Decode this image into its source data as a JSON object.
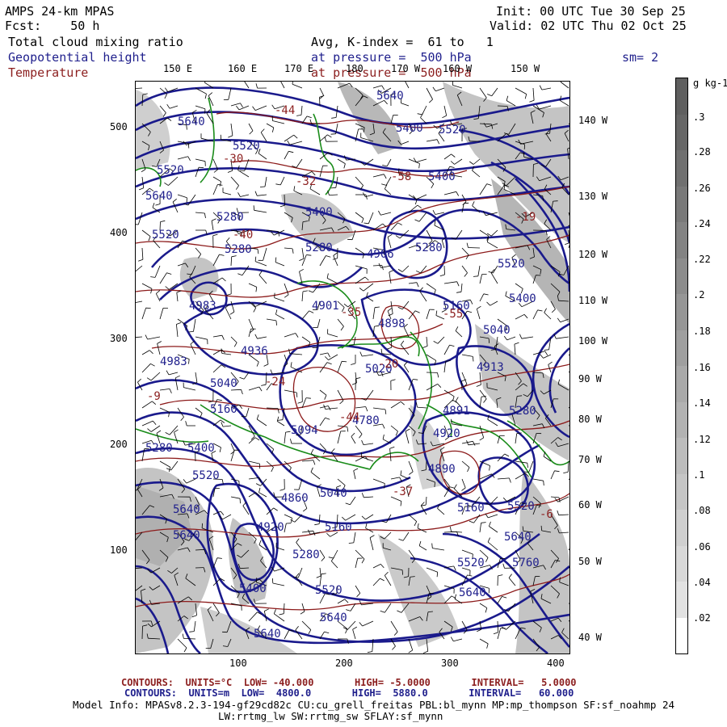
{
  "header": {
    "model": "AMPS 24-km MPAS",
    "forecast": "Fcst:    50 h",
    "init": "Init: 00 UTC Tue 30 Sep 25",
    "valid": "Valid: 02 UTC Thu 02 Oct 25",
    "field1": "Total cloud mixing ratio",
    "field2": "Geopotential height",
    "field3": "Temperature",
    "avg": "Avg, K-index =  61 to   1",
    "pressure_blue": "at pressure =  500 hPa",
    "pressure_red": "at pressure =  500 hPa",
    "smoothing": "sm= 2"
  },
  "colors": {
    "height_contour": "#1a1a8c",
    "temperature_contour": "#8c1a1a",
    "coastline": "#1a8c1a",
    "cloud_shading": "#bdbdbd"
  },
  "longitude_labels_top": [
    "150 E",
    "160 E",
    "170 E",
    "180",
    "170 W",
    "160 W",
    "150 W"
  ],
  "longitude_labels_right": [
    "140 W",
    "130 W",
    "120 W",
    "110 W",
    "100 W",
    "90 W",
    "80 W",
    "70 W",
    "60 W",
    "50 W",
    "40 W"
  ],
  "y_axis_ticks": [
    "500",
    "400",
    "300",
    "200",
    "100"
  ],
  "x_axis_ticks": [
    "100",
    "200",
    "300",
    "400"
  ],
  "colorbar": {
    "unit": "g kg-1",
    "labels": [
      ".3",
      ".28",
      ".26",
      ".24",
      ".22",
      ".2",
      ".18",
      ".16",
      ".14",
      ".12",
      ".1",
      ".08",
      ".06",
      ".04",
      ".02"
    ]
  },
  "contour_labels": {
    "height": [
      "5640",
      "5520",
      "5400",
      "5280",
      "4906",
      "5160",
      "5040",
      "4983",
      "4936",
      "4836",
      "5094",
      "4780",
      "4898",
      "4901",
      "4920",
      "4890",
      "4860",
      "5020",
      "5760",
      "4913",
      "4891"
    ],
    "temperature": [
      "-44",
      "-40",
      "-30",
      "-35",
      "-19",
      "-9",
      "-32",
      "-24",
      "-20",
      "-58",
      "-55",
      "-15",
      "-6",
      "-12",
      "-37"
    ]
  },
  "footer": {
    "line1_label": "CONTOURS:  UNITS=°C  LOW= -40.000       HIGH= -5.0000       INTERVAL=   5.0000",
    "line2_label": "CONTOURS:  UNITS=m  LOW=  4800.0       HIGH=  5880.0       INTERVAL=   60.000",
    "model_info": "Model Info: MPASv8.2.3-194-gf29cd82c CU:cu_grell_freitas PBL:bl_mynn MP:mp_thompson SF:sf_noahmp 24",
    "model_info2": "LW:rrtmg_lw SW:rrtmg_sw SFLAY:sf_mynn"
  }
}
